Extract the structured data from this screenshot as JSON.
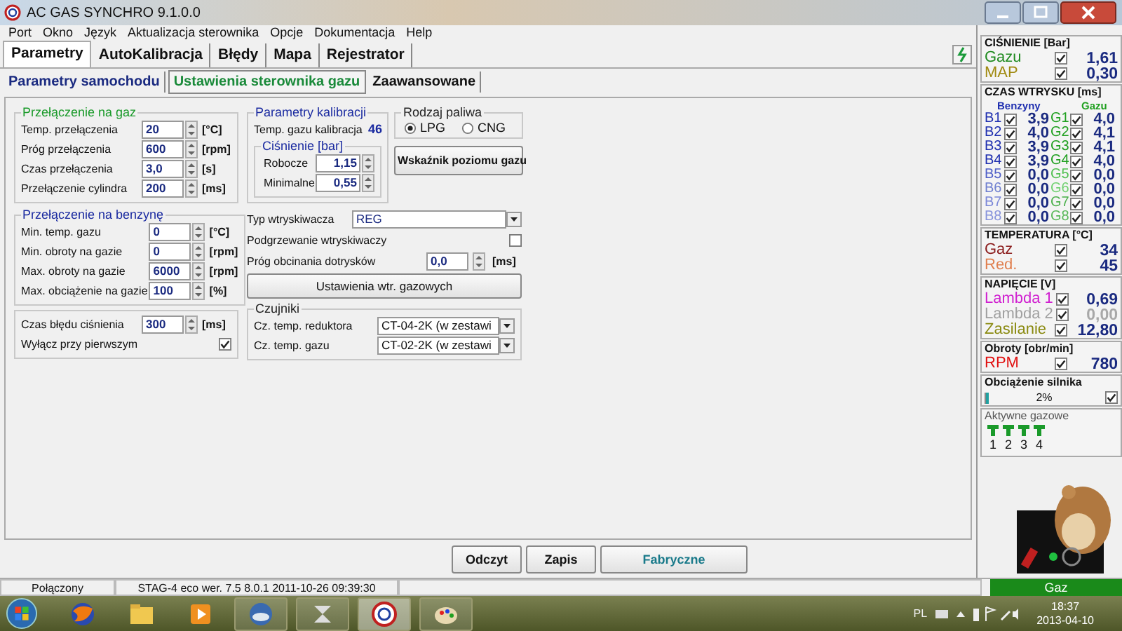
{
  "window": {
    "title": "AC GAS SYNCHRO  9.1.0.0"
  },
  "menu": [
    "Port",
    "Okno",
    "Język",
    "Aktualizacja sterownika",
    "Opcje",
    "Dokumentacja",
    "Help"
  ],
  "tabs": [
    {
      "label": "Parametry",
      "selected": true
    },
    {
      "label": "AutoKalibracja",
      "selected": false
    },
    {
      "label": "Błędy",
      "selected": false
    },
    {
      "label": "Mapa",
      "selected": false
    },
    {
      "label": "Rejestrator",
      "selected": false
    }
  ],
  "subtabs": [
    {
      "label": "Parametry samochodu",
      "selected": false
    },
    {
      "label": "Ustawienia sterownika gazu",
      "selected": true
    },
    {
      "label": "Zaawansowane",
      "selected": false
    }
  ],
  "switch_to_gas": {
    "title": "Przełączenie na gaz",
    "rows": [
      {
        "label": "Temp. przełączenia",
        "value": "20",
        "unit": "[°C]"
      },
      {
        "label": "Próg przełączenia",
        "value": "600",
        "unit": "[rpm]"
      },
      {
        "label": "Czas przełączenia",
        "value": "3,0",
        "unit": "[s]"
      },
      {
        "label": "Przełączenie cylindra",
        "value": "200",
        "unit": "[ms]"
      }
    ]
  },
  "switch_to_petrol": {
    "title": "Przełączenie na benzynę",
    "rows": [
      {
        "label": "Min. temp. gazu",
        "value": "0",
        "unit": "[°C]"
      },
      {
        "label": "Min. obroty na gazie",
        "value": "0",
        "unit": "[rpm]"
      },
      {
        "label": "Max. obroty na gazie",
        "value": "6000",
        "unit": "[rpm]"
      },
      {
        "label": "Max. obciążenie na gazie",
        "value": "100",
        "unit": "[%]"
      }
    ]
  },
  "pressure_error": {
    "rows": [
      {
        "kind": "spin",
        "label": "Czas błędu ciśnienia",
        "value": "300",
        "unit": "[ms]"
      },
      {
        "kind": "check",
        "label": "Wyłącz przy pierwszym",
        "checked": true
      }
    ]
  },
  "calibration": {
    "title": "Parametry kalibracji",
    "temp_label": "Temp. gazu kalibracja",
    "temp_value": "46",
    "pressure_title": "Ciśnienie [bar]",
    "rows": [
      {
        "label": "Robocze",
        "value": "1,15"
      },
      {
        "label": "Minimalne",
        "value": "0,55"
      }
    ]
  },
  "fuel_type": {
    "title": "Rodzaj paliwa",
    "options": [
      {
        "label": "LPG",
        "selected": true
      },
      {
        "label": "CNG",
        "selected": false
      }
    ]
  },
  "gauge_button": "Wskaźnik poziomu gazu",
  "injectors": {
    "type_label": "Typ wtryskiwacza",
    "type_value": "REG",
    "heating_label": "Podgrzewanie wtryskiwaczy",
    "heating_checked": false,
    "cutoff_label": "Próg obcinania dotrysków",
    "cutoff_value": "0,0",
    "cutoff_unit": "[ms]",
    "settings_button": "Ustawienia wtr. gazowych"
  },
  "sensors": {
    "title": "Czujniki",
    "rows": [
      {
        "label": "Cz. temp. reduktora",
        "value": "CT-04-2K (w zestawi"
      },
      {
        "label": "Cz. temp. gazu",
        "value": "CT-02-2K (w zestawi"
      }
    ]
  },
  "buttons": [
    {
      "label": "Odczyt",
      "kind": "plain"
    },
    {
      "label": "Zapis",
      "kind": "plain"
    },
    {
      "label": "Fabryczne",
      "kind": "accent"
    }
  ],
  "status_bar": [
    "Połączony",
    "STAG-4 eco   wer. 7.5  8.0.1     2011-10-26 09:39:30"
  ],
  "monitor": {
    "pressure": {
      "title": "CIŚNIENIE [Bar]",
      "rows": [
        {
          "label": "Gazu",
          "checked": true,
          "value": "1,61",
          "color": "#1f8a1f"
        },
        {
          "label": "MAP",
          "checked": true,
          "value": "0,30",
          "color": "#a08a10"
        }
      ]
    },
    "injection": {
      "title": "CZAS WTRYSKU [ms]",
      "petrol_header": "Benzyny",
      "gas_header": "Gazu",
      "rows": [
        {
          "petrol": {
            "label": "B1",
            "checked": true,
            "value": "3,9",
            "color": "#2030b0"
          },
          "gas": {
            "label": "G1",
            "checked": true,
            "value": "4,0",
            "color": "#20a020"
          }
        },
        {
          "petrol": {
            "label": "B2",
            "checked": true,
            "value": "4,0",
            "color": "#2030b0"
          },
          "gas": {
            "label": "G2",
            "checked": true,
            "value": "4,1",
            "color": "#20a020"
          }
        },
        {
          "petrol": {
            "label": "B3",
            "checked": true,
            "value": "3,9",
            "color": "#2030b0"
          },
          "gas": {
            "label": "G3",
            "checked": true,
            "value": "4,1",
            "color": "#20a020"
          }
        },
        {
          "petrol": {
            "label": "B4",
            "checked": true,
            "value": "3,9",
            "color": "#2030b0"
          },
          "gas": {
            "label": "G4",
            "checked": true,
            "value": "4,0",
            "color": "#20a020"
          }
        },
        {
          "petrol": {
            "label": "B5",
            "checked": true,
            "value": "0,0",
            "color": "#5060c8"
          },
          "gas": {
            "label": "G5",
            "checked": true,
            "value": "0,0",
            "color": "#50c050"
          }
        },
        {
          "petrol": {
            "label": "B6",
            "checked": true,
            "value": "0,0",
            "color": "#7080d0"
          },
          "gas": {
            "label": "G6",
            "checked": true,
            "value": "0,0",
            "color": "#70d070"
          }
        },
        {
          "petrol": {
            "label": "B7",
            "checked": true,
            "value": "0,0",
            "color": "#7c88d8"
          },
          "gas": {
            "label": "G7",
            "checked": true,
            "value": "0,0",
            "color": "#4cb04c"
          }
        },
        {
          "petrol": {
            "label": "B8",
            "checked": true,
            "value": "0,0",
            "color": "#8894dc"
          },
          "gas": {
            "label": "G8",
            "checked": true,
            "value": "0,0",
            "color": "#58b858"
          }
        }
      ]
    },
    "temperature": {
      "title": "TEMPERATURA  [°C]",
      "rows": [
        {
          "label": "Gaz",
          "checked": true,
          "value": "34",
          "color": "#8a1a1a"
        },
        {
          "label": "Red.",
          "checked": true,
          "value": "45",
          "color": "#e08050"
        }
      ]
    },
    "voltage": {
      "title": "NAPIĘCIE [V]",
      "rows": [
        {
          "label": "Lambda 1",
          "checked": true,
          "value": "0,69",
          "color": "#d020d0",
          "disabled": false
        },
        {
          "label": "Lambda 2",
          "checked": true,
          "value": "0,00",
          "color": "#a0a0a0",
          "disabled": true
        },
        {
          "label": "Zasilanie",
          "checked": true,
          "value": "12,80",
          "color": "#8a8a10",
          "disabled": false
        }
      ]
    },
    "rpm": {
      "title": "Obroty [obr/min]",
      "label": "RPM",
      "checked": true,
      "value": "780",
      "color": "#e01010"
    },
    "load": {
      "title": "Obciążenie silnika",
      "level": 0.02,
      "reading": "2%",
      "checked": true
    },
    "active": {
      "title": "Aktywne gazowe",
      "items": [
        "1",
        "2",
        "3",
        "4"
      ]
    },
    "mode": "Gaz"
  },
  "taskbar": {
    "language": "PL",
    "time": "18:37",
    "date": "2013-04-10"
  }
}
